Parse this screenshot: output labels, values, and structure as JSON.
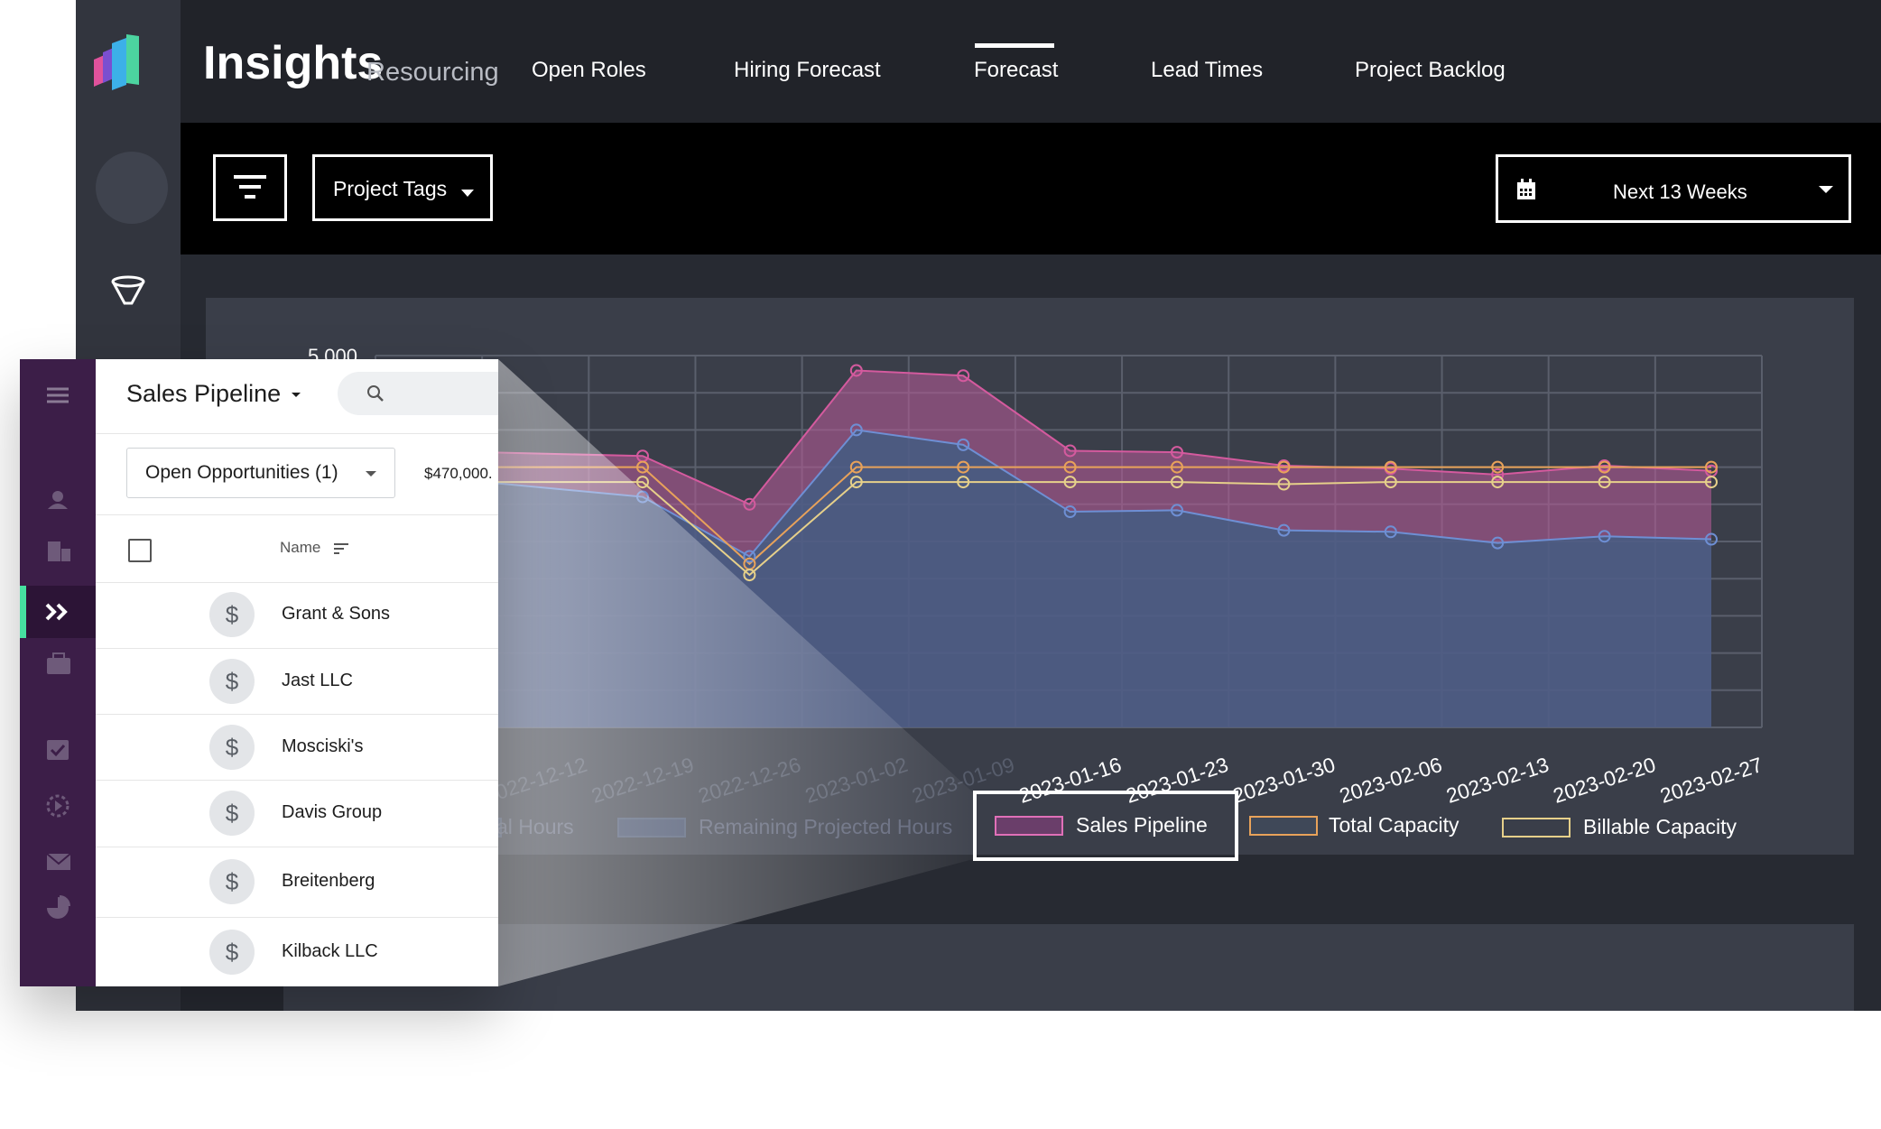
{
  "app": {
    "brand": "Insights",
    "brand_sub": "Resourcing",
    "nav": [
      "Open Roles",
      "Hiring Forecast",
      "Forecast",
      "Lead Times",
      "Project Backlog"
    ],
    "active_nav": "Forecast"
  },
  "toolbar": {
    "tags_label": "Project Tags",
    "date_range": "Next 13 Weeks"
  },
  "chart_data": {
    "type": "area",
    "ytick_top": "5,000",
    "ylim": [
      0,
      5000
    ],
    "x": [
      "2022-12-12",
      "2022-12-19",
      "2022-12-26",
      "2023-01-02",
      "2023-01-09",
      "2023-01-16",
      "2023-01-23",
      "2023-01-30",
      "2023-02-06",
      "2023-02-13",
      "2023-02-20",
      "2023-02-27"
    ],
    "series": [
      {
        "name": "Sales Pipeline",
        "values": [
          3700,
          3650,
          3000,
          4800,
          4730,
          3720,
          3700,
          3520,
          3480,
          3400,
          3520,
          3450
        ]
      },
      {
        "name": "Total Capacity",
        "values": [
          3500,
          3500,
          2200,
          3500,
          3500,
          3500,
          3500,
          3500,
          3500,
          3500,
          3500,
          3500
        ]
      },
      {
        "name": "Billable Capacity",
        "values": [
          3300,
          3300,
          2050,
          3300,
          3300,
          3300,
          3300,
          3270,
          3300,
          3300,
          3300,
          3300
        ]
      },
      {
        "values": [
          3300,
          3100,
          2300,
          4000,
          3800,
          2900,
          2920,
          2650,
          2630,
          2480,
          2570,
          2530
        ]
      }
    ],
    "legend": [
      "Total Hours",
      "Remaining Projected Hours",
      "Sales Pipeline",
      "Total Capacity",
      "Billable Capacity"
    ],
    "legend_visible": [
      "al Hours",
      "Remaining Projected Hours",
      "Sales Pipeline",
      "Total Capacity",
      "Billable Capacity"
    ],
    "colors": {
      "pipeline": "#d45a9e",
      "total": "#e8a25a",
      "billable": "#e6d08a",
      "projected": "#6e8fd4"
    }
  },
  "overlay": {
    "title": "Sales Pipeline",
    "filter_label": "Open Opportunities (1)",
    "amount": "$470,000.",
    "col_name": "Name",
    "rows": [
      "Grant & Sons",
      "Jast LLC",
      "Mosciski's",
      "Davis Group",
      "Breitenberg",
      "Kilback LLC"
    ],
    "row_icon": "$"
  }
}
